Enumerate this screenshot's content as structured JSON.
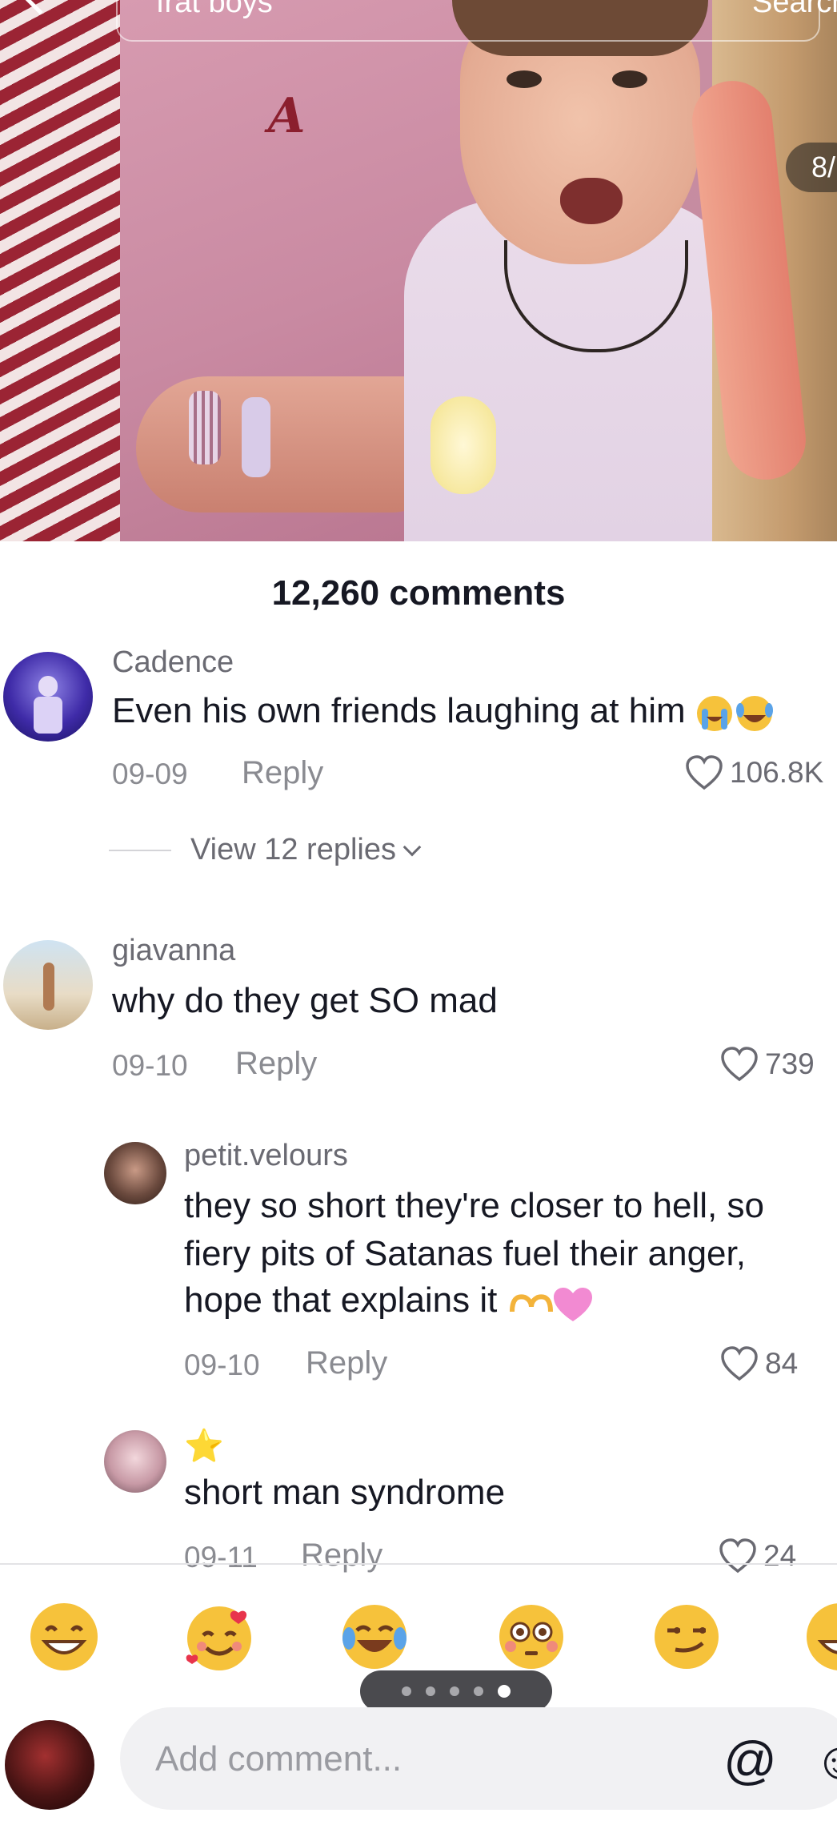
{
  "header": {
    "search_text": "frat boys",
    "search_button": "Search",
    "page_indicator": "8/"
  },
  "comments_count": "12,260 comments",
  "comments": [
    {
      "username": "Cadence",
      "text": "Even his own friends laughing at him",
      "date": "09-09",
      "reply_label": "Reply",
      "likes": "106.8K",
      "view_replies": "View 12 replies"
    },
    {
      "username": "giavanna",
      "text": "why do they get SO mad",
      "date": "09-10",
      "reply_label": "Reply",
      "likes": "739"
    },
    {
      "username": "petit.velours",
      "text_line1": "they so short they're closer to hell, so",
      "text_line2": "fiery pits of Satanas fuel their anger,",
      "text_line3": "hope that explains it",
      "date": "09-10",
      "reply_label": "Reply",
      "likes": "84"
    },
    {
      "username": "⭐",
      "text": "short man syndrome",
      "date": "09-11",
      "reply_label": "Reply",
      "likes": "24"
    }
  ],
  "quick_emojis": [
    "😁",
    "🥰",
    "😂",
    "😳",
    "😏",
    "😁"
  ],
  "input": {
    "placeholder": "Add comment...",
    "at_label": "@",
    "emoji_label": "☺"
  },
  "colors": {
    "text": "#161823",
    "muted": "#8a8b91",
    "input_bg": "#f1f1f3"
  }
}
